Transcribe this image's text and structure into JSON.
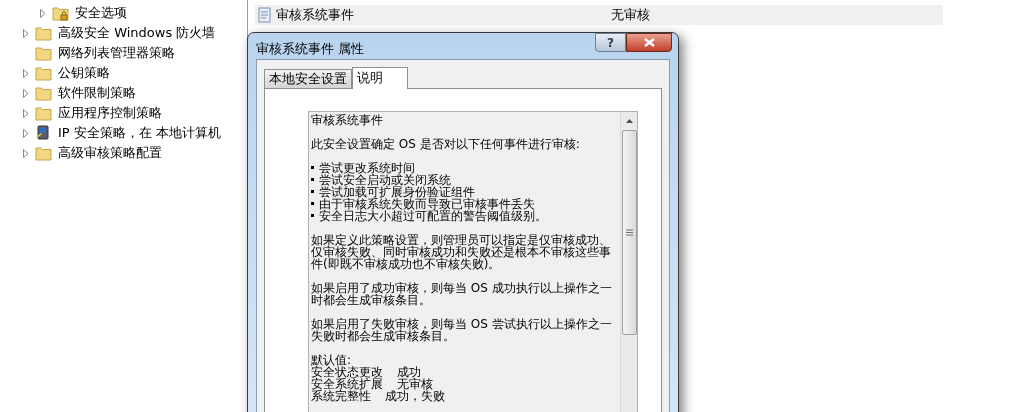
{
  "tree": [
    {
      "children": [
        {
          "label": "安全选项",
          "kind": "locked-folder",
          "expandable": true
        }
      ]
    },
    {
      "label": "高级安全 Windows 防火墙",
      "kind": "folder",
      "expandable": true
    },
    {
      "label": "网络列表管理器策略",
      "kind": "folder",
      "expandable": false
    },
    {
      "label": "公钥策略",
      "kind": "folder",
      "expandable": true
    },
    {
      "label": "软件限制策略",
      "kind": "folder",
      "expandable": true
    },
    {
      "label": "应用程序控制策略",
      "kind": "folder",
      "expandable": true
    },
    {
      "label": "IP 安全策略，在 本地计算机",
      "kind": "computer",
      "expandable": true
    },
    {
      "label": "高级审核策略配置",
      "kind": "folder",
      "expandable": true
    }
  ],
  "policy_list": {
    "rows": [
      {
        "name": "审核系统事件",
        "value": "无审核",
        "selected": true
      }
    ]
  },
  "dialog": {
    "title": "审核系统事件 属性",
    "help_button": "?",
    "tabs": [
      {
        "label": "本地安全设置",
        "selected": false
      },
      {
        "label": "说明",
        "selected": true
      }
    ],
    "explanation": {
      "heading": "审核系统事件",
      "paragraphs": [
        "此安全设置确定 OS 是否对以下任何事件进行审核:"
      ],
      "bullets": [
        "尝试更改系统时间",
        "尝试安全启动或关闭系统",
        "尝试加载可扩展身份验证组件",
        "由于审核系统失败而导致已审核事件丢失",
        "安全日志大小超过可配置的警告阈值级别。"
      ],
      "more_paragraphs": [
        "如果定义此策略设置，则管理员可以指定是仅审核成功、仅审核失败、同时审核成功和失败还是根本不审核这些事件(即既不审核成功也不审核失败)。",
        "如果启用了成功审核，则每当 OS 成功执行以上操作之一时都会生成审核条目。",
        "如果启用了失败审核，则每当 OS 尝试执行以上操作之一失败时都会生成审核条目。"
      ],
      "defaults_heading": "默认值:",
      "defaults": [
        {
          "setting": "安全状态更改",
          "value": "成功"
        },
        {
          "setting": "安全系统扩展",
          "value": "无审核"
        },
        {
          "setting": "系统完整性",
          "value": "成功，失败"
        }
      ]
    }
  }
}
